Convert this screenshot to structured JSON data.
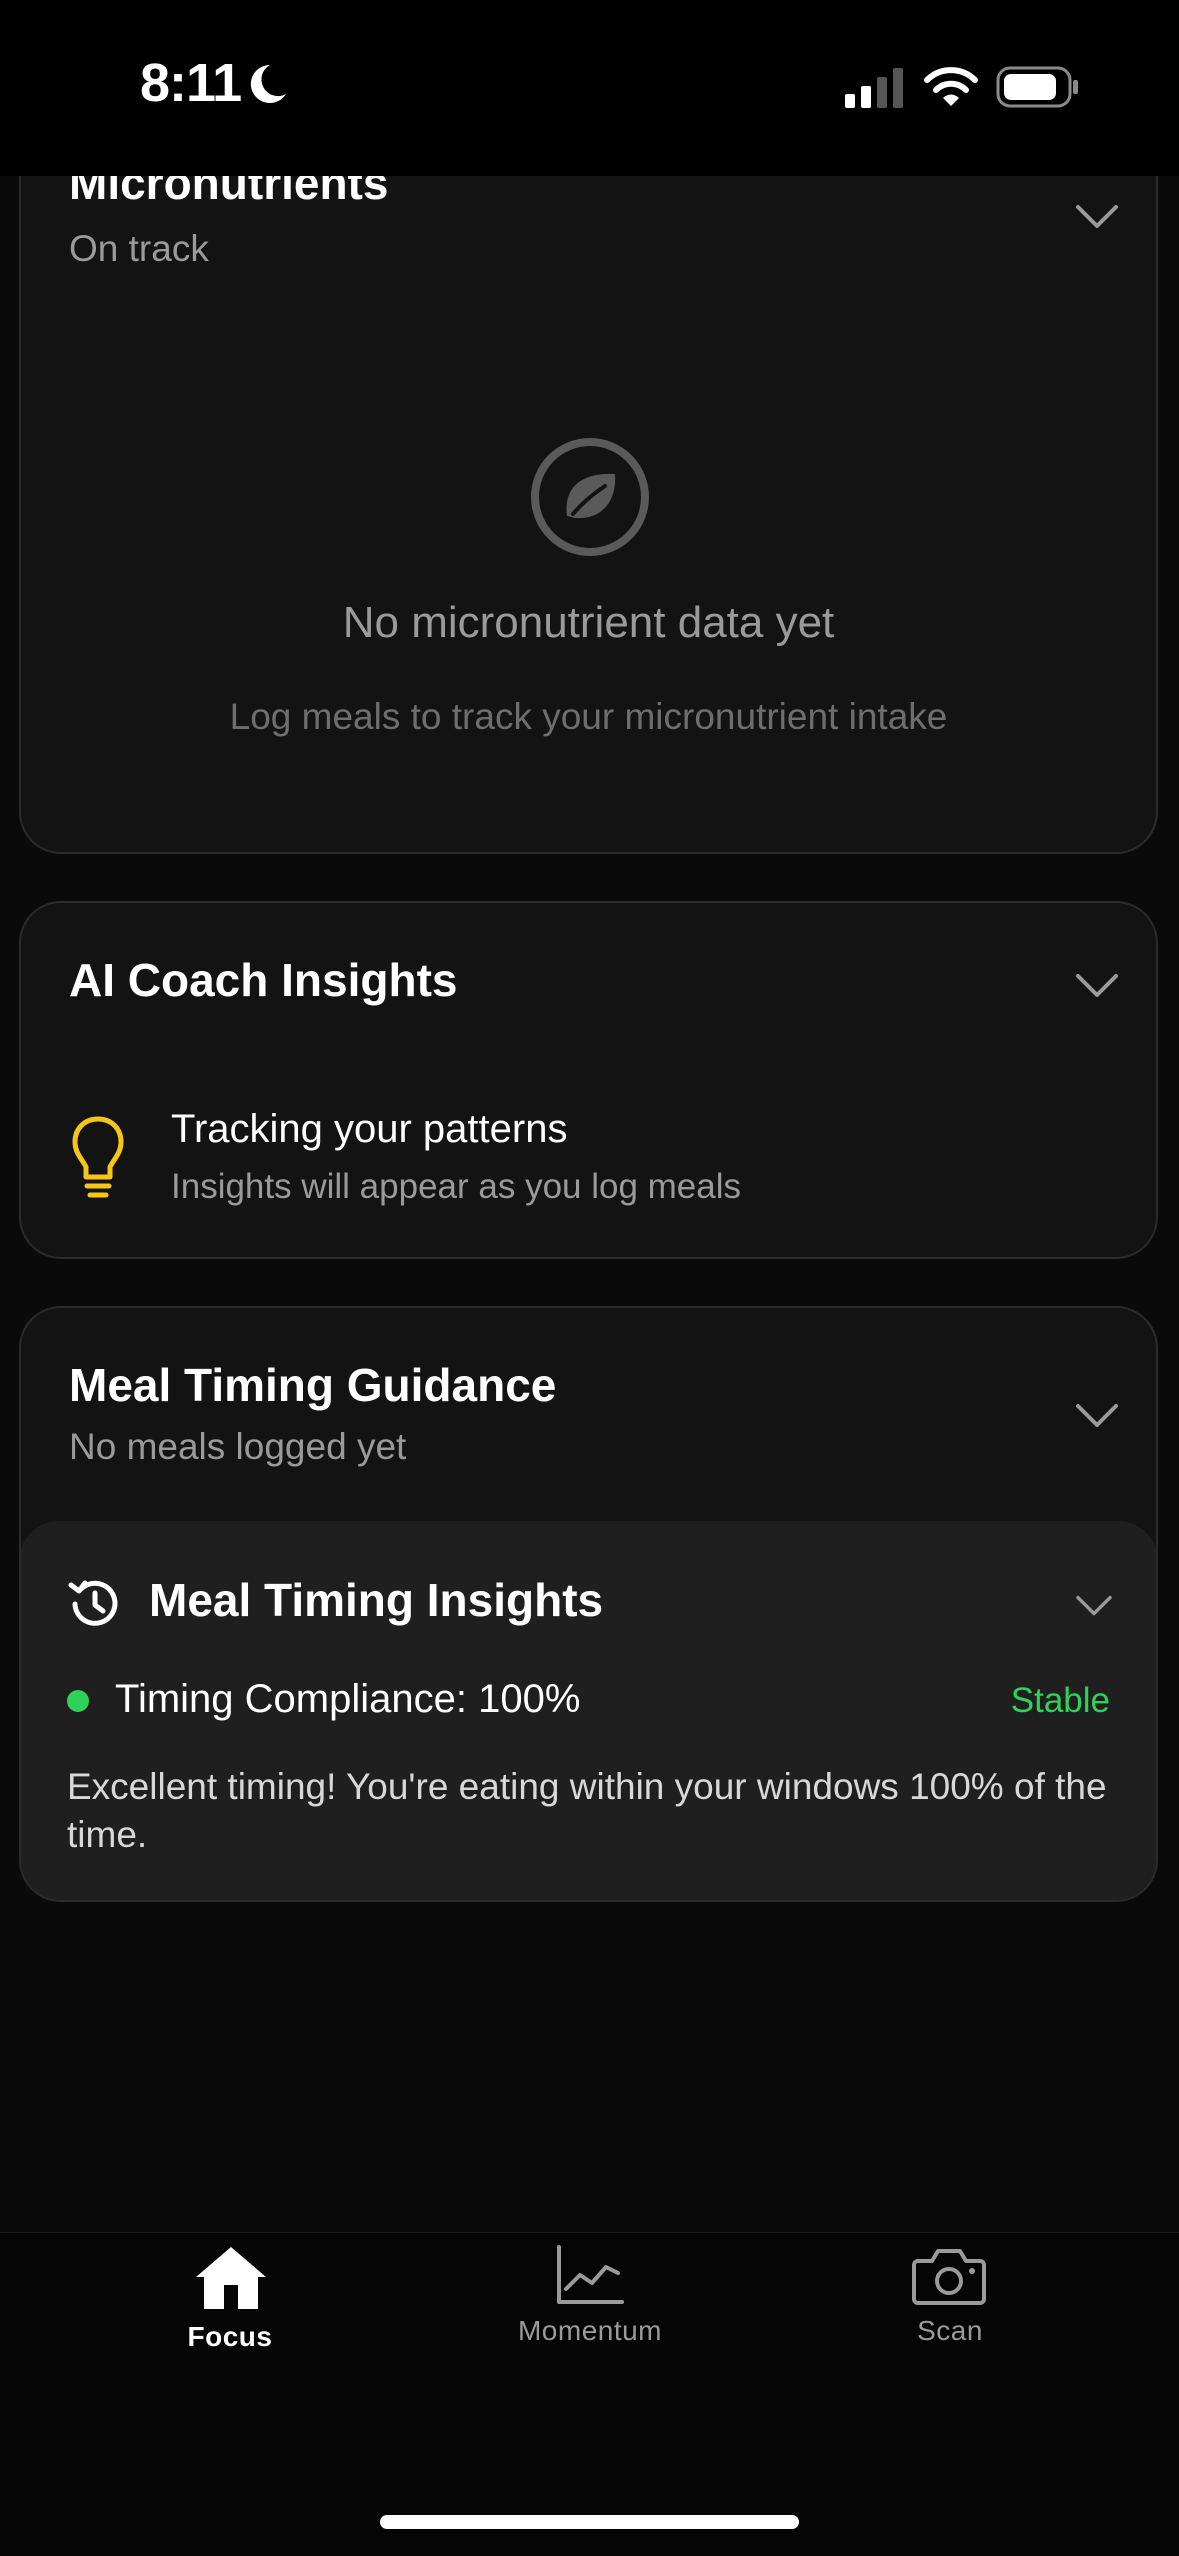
{
  "status_bar": {
    "time": "8:11"
  },
  "micronutrients": {
    "title": "Micronutrients",
    "subtitle": "On track",
    "empty_title": "No micronutrient data yet",
    "empty_message": "Log meals to track your micronutrient intake"
  },
  "ai_coach": {
    "title": "AI Coach Insights",
    "insight_title": "Tracking your patterns",
    "insight_message": "Insights will appear as you log meals"
  },
  "meal_timing": {
    "title": "Meal Timing Guidance",
    "subtitle": "No meals logged yet",
    "insights": {
      "title": "Meal Timing Insights",
      "compliance_label": "Timing Compliance: 100%",
      "trend": "Stable",
      "message": "Excellent timing! You're eating within your windows 100% of the time."
    }
  },
  "tabs": [
    {
      "label": "Focus",
      "icon": "home-icon",
      "active": true
    },
    {
      "label": "Momentum",
      "icon": "chart-line-icon",
      "active": false
    },
    {
      "label": "Scan",
      "icon": "camera-icon",
      "active": false
    }
  ],
  "colors": {
    "background": "#0a0a0a",
    "card": "#131313",
    "accent_green": "#30d158",
    "bulb_yellow": "#f5c518"
  }
}
